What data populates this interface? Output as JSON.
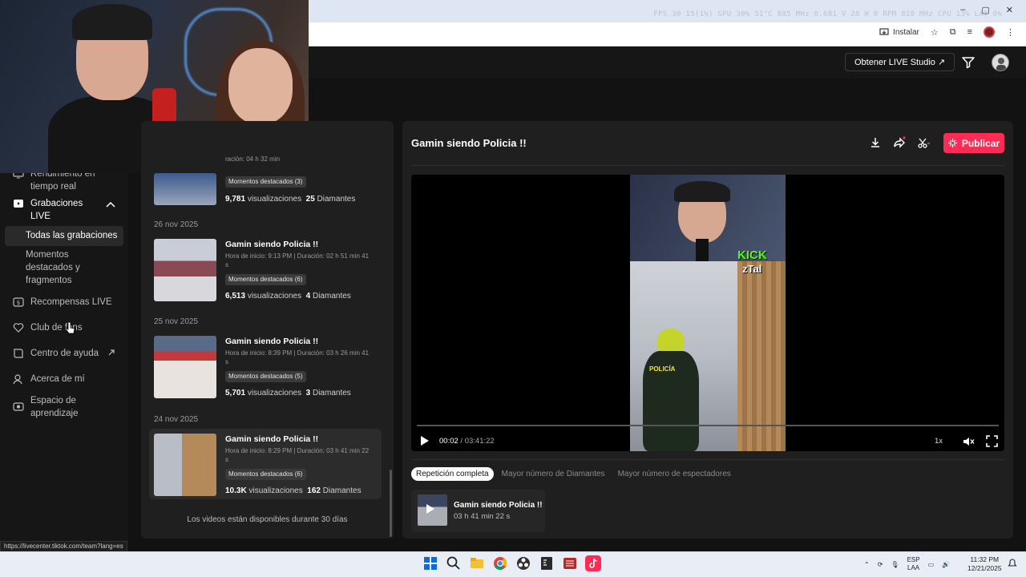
{
  "browser": {
    "stats_text": "FPS 30 15(1%) GPU 30% 51°C 885 MHz 0.681 V 28 W 0 RPM 810 MHz CPU 13% LAT 0%",
    "install_label": "Instalar"
  },
  "header": {
    "studio_button": "Obtener LIVE Studio ↗"
  },
  "sidebar": {
    "items": [
      {
        "label": "Rendimiento en tiempo real"
      },
      {
        "label": "Grabaciones LIVE"
      },
      {
        "label": "Todas las grabaciones"
      },
      {
        "label": "Momentos destacados y fragmentos"
      },
      {
        "label": "Recompensas LIVE"
      },
      {
        "label": "Club de fans"
      },
      {
        "label": "Centro de ayuda"
      },
      {
        "label": "Acerca de mí"
      },
      {
        "label": "Espacio de aprendizaje"
      }
    ],
    "status_url": "https://livecenter.tiktok.com/team?lang=es"
  },
  "recordings": {
    "partial_top": {
      "meta": "ración: 04 h 32 min",
      "chip": "Momentos destacados (3)",
      "views": "9,781",
      "views_label": "visualizaciones",
      "diamonds": "25",
      "diamonds_label": "Diamantes"
    },
    "groups": [
      {
        "date": "26 nov 2025",
        "title": "Gamin siendo Policia !!",
        "meta": "Hora de inicio: 9:13 PM | Duración: 02 h 51 min 41 s",
        "chip": "Momentos destacados (6)",
        "views": "6,513",
        "views_label": "visualizaciones",
        "diamonds": "4",
        "diamonds_label": "Diamantes"
      },
      {
        "date": "25 nov 2025",
        "title": "Gamin siendo Policia !!",
        "meta": "Hora de inicio: 8:39 PM | Duración: 03 h 26 min 41 s",
        "chip": "Momentos destacados (5)",
        "views": "5,701",
        "views_label": "visualizaciones",
        "diamonds": "3",
        "diamonds_label": "Diamantes"
      },
      {
        "date": "24 nov 2025",
        "title": "Gamin siendo Policia !!",
        "meta": "Hora de inicio: 8:29 PM | Duración: 03 h 41 min 22 s",
        "chip": "Momentos destacados (6)",
        "views": "10.3K",
        "views_label": "visualizaciones",
        "diamonds": "162",
        "diamonds_label": "Diamantes"
      }
    ],
    "footnote": "Los videos están disponibles durante 30 días"
  },
  "player": {
    "title": "Gamin siendo Policia !!",
    "publish_label": "Publicar",
    "overlay_kick": "KICK",
    "overlay_name": "zTal",
    "cop_label": "POLICÍA",
    "current_time": "00:02",
    "separator": " / ",
    "duration": "03:41:22",
    "speed": "1x",
    "tabs": [
      "Repetición completa",
      "Mayor número de Diamantes",
      "Mayor número de espectadores"
    ],
    "clip": {
      "title": "Gamin siendo Policia !!",
      "duration": "03 h 41 min 22 s"
    }
  },
  "taskbar": {
    "lang_top": "ESP",
    "lang_bottom": "LAA",
    "time": "11:32 PM",
    "date": "12/21/2025"
  },
  "colors": {
    "accent": "#fe2c55",
    "background": "#121212",
    "panel": "#1f1f1f"
  }
}
